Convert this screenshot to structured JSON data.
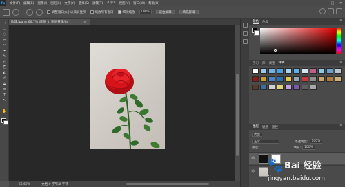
{
  "app": {
    "logo": "Ps"
  },
  "menu": [
    "文件(F)",
    "编辑(E)",
    "图像(I)",
    "图层(L)",
    "文字(Y)",
    "选择(S)",
    "滤镜(T)",
    "3D(D)",
    "视图(V)",
    "窗口(W)",
    "帮助(H)"
  ],
  "window_controls": [
    "—",
    "□",
    "✕"
  ],
  "options": {
    "resize_windows": "调整窗口大小以满屏显示",
    "zoom_all": "缩放所有窗口",
    "scrubby_zoom": "细微缩放",
    "zoom_value": "100%",
    "fit_screen": "适合屏幕",
    "fill_screen": "填充屏幕"
  },
  "document": {
    "tab_title": "玫瑰.jpg @ 66.7% (图层 1, 图层蒙版/8) *",
    "close": "×"
  },
  "status": {
    "zoom": "66.67%",
    "info": "文档:0 字节/0 字节"
  },
  "tools": [
    "⇢",
    "▭",
    "◌",
    "⌗",
    "✂",
    "⌖",
    "✎",
    "✍",
    "⎘",
    "◐",
    "✐",
    "◒",
    "⬭",
    "T",
    "↖",
    "▢",
    "✋",
    "🔍",
    "⋯"
  ],
  "panels": {
    "color_tabs": [
      "颜色",
      "色板"
    ],
    "adjust_tabs": [
      "学习",
      "库",
      "调整",
      "样式"
    ],
    "layer_tabs": [
      "图层",
      "通道",
      "路径"
    ],
    "menu_icon": "≡"
  },
  "layers": {
    "filter_label": "类型",
    "blend_mode": "正常",
    "opacity_label": "不透明度:",
    "opacity": "100%",
    "lock_label": "锁定:",
    "fill_label": "填充:",
    "fill": "100%",
    "eye": "👁"
  },
  "colors": {
    "rose_red": "#d8141b",
    "leaf_green": "#2e6b2a",
    "accent": "#31a8ff"
  },
  "watermark": {
    "paw": "🐾",
    "brand": "Bai 经验",
    "url": "jingyan.baidu.com"
  }
}
